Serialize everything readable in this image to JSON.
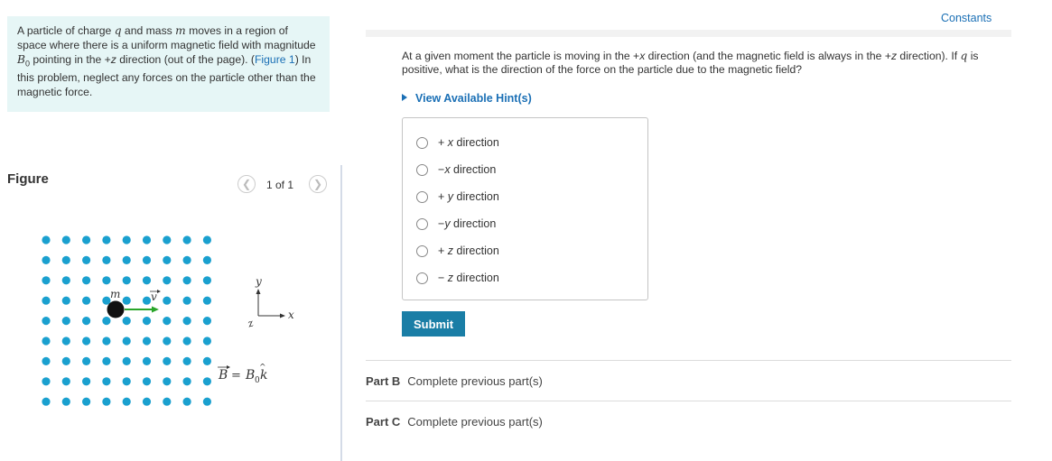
{
  "intro": {
    "seg1": "A particle of charge ",
    "q": "q",
    "seg2": " and mass ",
    "m": "m",
    "seg3": " moves in a region of space where there is a uniform magnetic field with magnitude ",
    "B": "B",
    "sub0": "0",
    "seg4": " pointing in the +",
    "z": "z",
    "seg5": " direction (out of the page). (",
    "figure_link": "Figure 1",
    "seg6": ") In this problem, neglect any forces on the particle other than the magnetic force."
  },
  "figure": {
    "title": "Figure",
    "pager": "1 of 1",
    "prev_icon": "chevron-left-icon",
    "next_icon": "chevron-right-icon",
    "dot_color": "#1aa0cf",
    "particle_label": "m",
    "velocity_label": "v",
    "axis_y": "y",
    "axis_x": "x",
    "axis_z": "z",
    "field_eq_B": "B",
    "field_eq_eq": "=",
    "field_eq_rhs_B": "B",
    "field_eq_sub": "0",
    "field_eq_k": "k"
  },
  "constants_link": "Constants",
  "question": {
    "seg1": "At a given moment the particle is moving in the +",
    "x": "x",
    "seg2": " direction (and the magnetic field is always in the +",
    "z": "z",
    "seg3": " direction). If ",
    "q": "q",
    "seg4": " is positive, what is the direction of the force on the particle due to the magnetic field?"
  },
  "hint_toggle": "View Available Hint(s)",
  "options": [
    {
      "sign": "+",
      "axis": "x",
      "rest": " direction"
    },
    {
      "sign": "−",
      "axis": "x",
      "rest": " direction"
    },
    {
      "sign": "+",
      "axis": "y",
      "rest": " direction"
    },
    {
      "sign": "−",
      "axis": "y",
      "rest": " direction"
    },
    {
      "sign": "+",
      "axis": "z",
      "rest": " direction"
    },
    {
      "sign": "−",
      "axis": "z",
      "rest": " direction"
    }
  ],
  "submit_label": "Submit",
  "parts": [
    {
      "label": "Part B",
      "text": "Complete previous part(s)"
    },
    {
      "label": "Part C",
      "text": "Complete previous part(s)"
    }
  ],
  "colors": {
    "accent_link": "#1a6fb5",
    "submit_bg": "#1a7ea6",
    "intro_bg": "#e6f6f6",
    "velocity_arrow": "#2aa52a"
  }
}
